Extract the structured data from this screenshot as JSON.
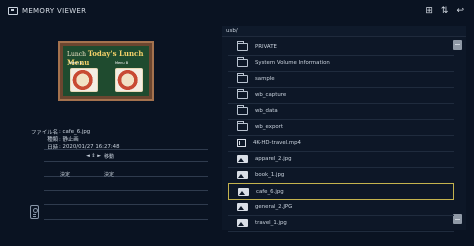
{
  "header": {
    "title": "MEMORY VIEWER",
    "icons": [
      "view-mode-icon",
      "sort-icon",
      "return-icon"
    ]
  },
  "preview": {
    "board_title_prefix": "Lunch",
    "board_title": "Today's Lunch Menu",
    "tag_left": "Menu A",
    "tag_right": "Menu B"
  },
  "file_info": {
    "filename_label": "ファイル名",
    "filename": ": cafe_6.jpg",
    "type_label": "種類",
    "type": ": 静止画",
    "date_label": "日時",
    "date": ": 2020/01/27 16:27:48"
  },
  "controls": {
    "move_keys": "◄ ⇕ ►",
    "move_label": "移動",
    "enter_key": "決定",
    "enter_label": "決定"
  },
  "path": "usb/",
  "files": [
    {
      "type": "folder",
      "name": "PRIVATE"
    },
    {
      "type": "folder",
      "name": "System Volume Information"
    },
    {
      "type": "folder",
      "name": "sample"
    },
    {
      "type": "folder",
      "name": "wb_capture"
    },
    {
      "type": "folder",
      "name": "wb_data"
    },
    {
      "type": "folder",
      "name": "wb_export"
    },
    {
      "type": "video",
      "name": "4K-HD-travel.mp4"
    },
    {
      "type": "image",
      "name": "apparel_2.jpg"
    },
    {
      "type": "image",
      "name": "book_1.jpg"
    },
    {
      "type": "image",
      "name": "cafe_6.jpg",
      "selected": true
    },
    {
      "type": "image",
      "name": "general_2.JPG"
    },
    {
      "type": "image",
      "name": "travel_1.jpg"
    }
  ]
}
